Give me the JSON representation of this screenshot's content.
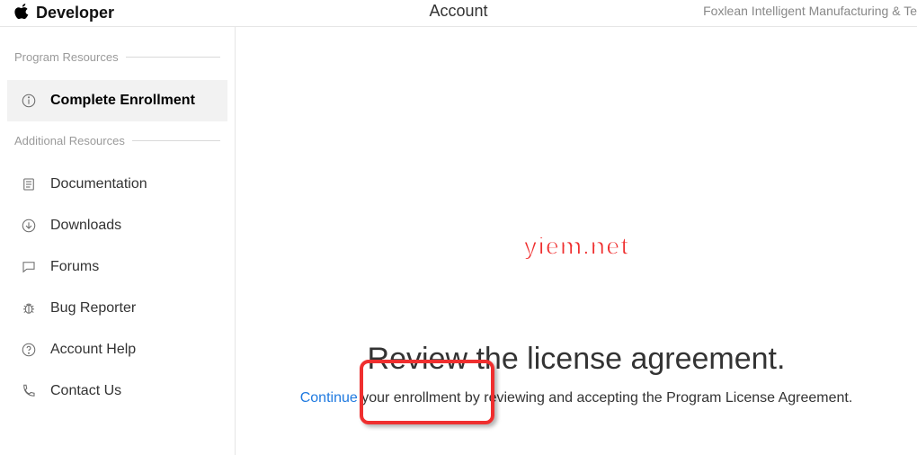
{
  "header": {
    "brand_label": "Developer",
    "title": "Account",
    "org_name": "Foxlean Intelligent Manufacturing & Te"
  },
  "sidebar": {
    "group1_label": "Program Resources",
    "group2_label": "Additional Resources",
    "enroll_label": "Complete Enrollment",
    "items": [
      {
        "label": "Documentation"
      },
      {
        "label": "Downloads"
      },
      {
        "label": "Forums"
      },
      {
        "label": "Bug Reporter"
      },
      {
        "label": "Account Help"
      },
      {
        "label": "Contact Us"
      }
    ]
  },
  "main": {
    "title": "Review the license agreement.",
    "continue_label": "Continue",
    "subtitle_rest": " your enrollment by reviewing and accepting the Program License Agreement."
  },
  "watermark": "yiem.net"
}
